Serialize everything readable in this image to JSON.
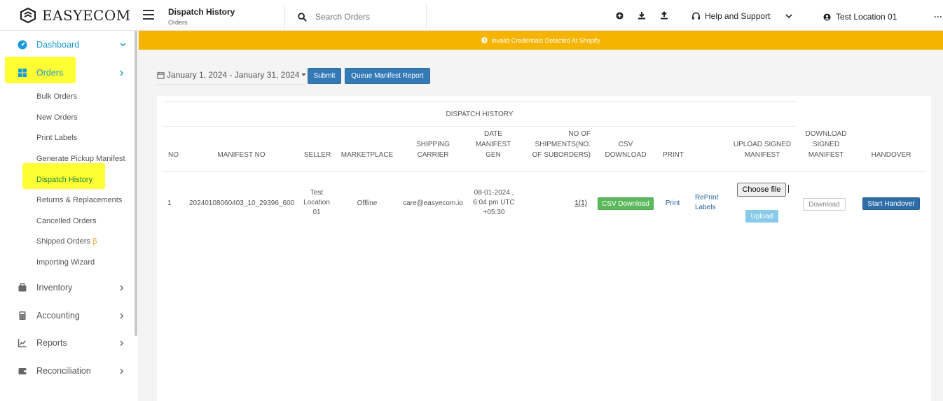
{
  "brand": {
    "name": "EASYECOM"
  },
  "header": {
    "title": "Dispatch History",
    "breadcrumb": "Orders",
    "search_placeholder": "Search Orders",
    "help_label": "Help and Support",
    "location_label": "Test Location 01",
    "more_label": "···"
  },
  "banner": {
    "text": "Invalid Credentials Detected At Shopify"
  },
  "sidebar": {
    "dashboard": "Dashboard",
    "orders": "Orders",
    "order_subitems": [
      "Bulk Orders",
      "New Orders",
      "Print Labels",
      "Generate Pickup Manifest",
      "Dispatch History",
      "Returns & Replacements",
      "Cancelled Orders",
      "Shipped Orders",
      "Importing Wizard"
    ],
    "beta_mark": "β",
    "inventory": "Inventory",
    "accounting": "Accounting",
    "reports": "Reports",
    "reconciliation": "Reconciliation"
  },
  "filters": {
    "date_range": "January 1, 2024 - January 31, 2024",
    "submit_label": "Submit",
    "queue_label": "Queue Manifest Report"
  },
  "table": {
    "title": "DISPATCH HISTORY",
    "headers": {
      "no": "NO",
      "manifest_no": "MANIFEST NO",
      "seller": "SELLER",
      "marketplace": "MARKETPLACE",
      "shipping_carrier": [
        "SHIPPING",
        "CARRIER"
      ],
      "date_manifest_gen": [
        "DATE",
        "MANIFEST",
        "GEN"
      ],
      "no_of_shipments": [
        "NO OF",
        "SHIPMENTS(NO.",
        "OF SUBORDERS)"
      ],
      "csv_download": [
        "CSV",
        "DOWNLOAD"
      ],
      "print": "PRINT",
      "upload_signed_manifest": [
        "UPLOAD SIGNED",
        "MANIFEST"
      ],
      "download_signed_manifest": [
        "DOWNLOAD",
        "SIGNED",
        "MANIFEST"
      ],
      "handover": "HANDOVER"
    },
    "rows": [
      {
        "no": "1",
        "manifest_no": "20240108060403_10_29396_600",
        "seller": [
          "Test",
          "Location",
          "01"
        ],
        "marketplace": "Offline",
        "shipping_carrier": "care@easyecom.io",
        "date": [
          "08-01-2024 ,",
          "6:04 pm UTC",
          "+05:30"
        ],
        "shipments": "1(1)",
        "csv_label": "CSV Download",
        "print_label": "Print",
        "reprint_label": [
          "RePrint",
          "Labels"
        ],
        "choose_file_label": "Choose file",
        "upload_label": "Upload",
        "download_label": "Download",
        "handover_label": "Start Handover"
      }
    ]
  },
  "colors": {
    "banner": "#f5b400",
    "highlight": "#ffff33",
    "primary": "#337ab7",
    "success": "#5cb85c",
    "active_nav": "#1a9bd7"
  }
}
